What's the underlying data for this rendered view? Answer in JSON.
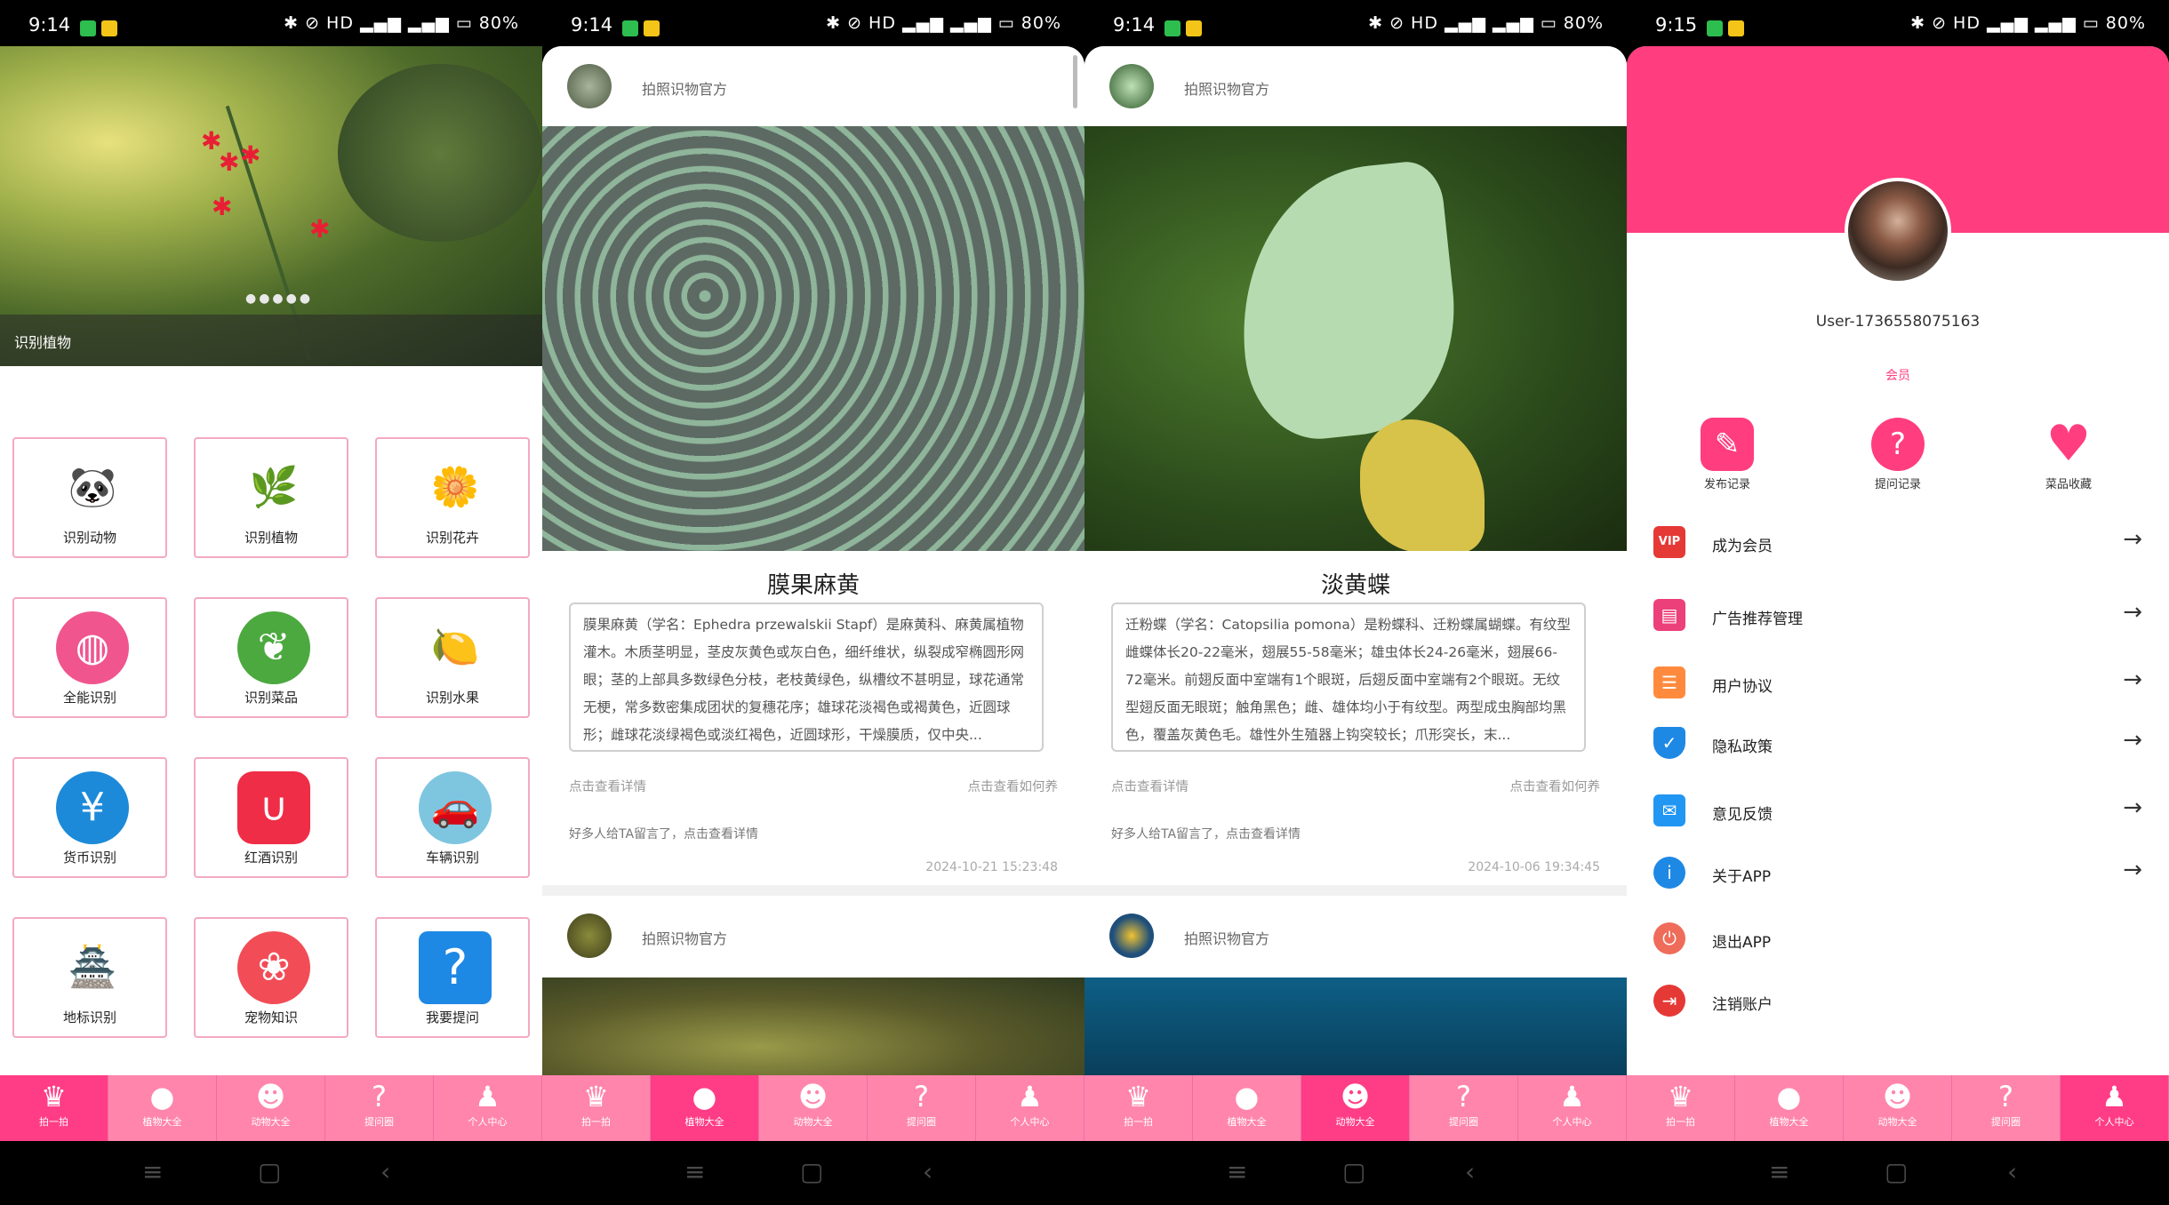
{
  "status": [
    {
      "time": "9:14",
      "battery": "80%"
    },
    {
      "time": "9:14",
      "battery": "80%"
    },
    {
      "time": "9:14",
      "battery": "80%"
    },
    {
      "time": "9:15",
      "battery": "80%"
    }
  ],
  "tabs": [
    {
      "label": "拍一拍",
      "icon": "tulip-icon"
    },
    {
      "label": "植物大全",
      "icon": "apple-icon"
    },
    {
      "label": "动物大全",
      "icon": "panda-icon"
    },
    {
      "label": "提问圈",
      "icon": "question-icon"
    },
    {
      "label": "个人中心",
      "icon": "person-icon"
    }
  ],
  "home": {
    "banner_caption": "识别植物",
    "grid": [
      {
        "label": "识别动物",
        "icon": "panda-icon",
        "color": "#ffffff"
      },
      {
        "label": "识别植物",
        "icon": "plant-icon",
        "color": "#ffffff"
      },
      {
        "label": "识别花卉",
        "icon": "flower-icon",
        "color": "#ffffff"
      },
      {
        "label": "全能识别",
        "icon": "globe-icon",
        "color": "#f0558e"
      },
      {
        "label": "识别菜品",
        "icon": "leaf-icon",
        "color": "#4ca93f"
      },
      {
        "label": "识别水果",
        "icon": "citrus-icon",
        "color": "#ffffff"
      },
      {
        "label": "货币识别",
        "icon": "money-icon",
        "color": "#1c8ad9"
      },
      {
        "label": "红酒识别",
        "icon": "wine-icon",
        "color": "#ef2d46"
      },
      {
        "label": "车辆识别",
        "icon": "car-icon",
        "color": "#7ec5e0"
      },
      {
        "label": "地标识别",
        "icon": "landmark-icon",
        "color": "#ffffff"
      },
      {
        "label": "宠物知识",
        "icon": "paw-icon",
        "color": "#f24d57"
      },
      {
        "label": "我要提问",
        "icon": "question-icon",
        "color": "#1e88e5"
      }
    ]
  },
  "plants_feed": {
    "author": "拍照识物官方",
    "title": "膜果麻黄",
    "description": "膜果麻黄（学名：Ephedra przewalskii Stapf）是麻黄科、麻黄属植物灌木。木质茎明显，茎皮灰黄色或灰白色，细纤维状，纵裂成窄椭圆形网眼；茎的上部具多数绿色分枝，老枝黄绿色，纵槽纹不甚明显，球花通常无梗，常多数密集成团状的复穗花序；雄球花淡褐色或褐黄色，近圆球形；雌球花淡绿褐色或淡红褐色，近圆球形，干燥膜质，仅中央...",
    "detail_link": "点击查看详情",
    "care_link": "点击查看如何养",
    "comment": "好多人给TA留言了，点击查看详情",
    "date": "2024-10-21 15:23:48",
    "next_author": "拍照识物官方"
  },
  "animals_feed": {
    "author": "拍照识物官方",
    "title": "淡黄蝶",
    "description": "迁粉蝶（学名：Catopsilia pomona）是粉蝶科、迁粉蝶属蝴蝶。有纹型雌蝶体长20-22毫米，翅展55-58毫米；雄虫体长24-26毫米，翅展66-72毫米。前翅反面中室端有1个眼斑，后翅反面中室端有2个眼斑。无纹型翅反面无眼斑；触角黑色；雌、雄体均小于有纹型。两型成虫胸部均黑色，覆盖灰黄色毛。雄性外生殖器上钩突较长；爪形突长，末...",
    "detail_link": "点击查看详情",
    "care_link": "点击查看如何养",
    "comment": "好多人给TA留言了，点击查看详情",
    "date": "2024-10-06 19:34:45",
    "next_author": "拍照识物官方"
  },
  "profile": {
    "username": "User-1736558075163",
    "membership": "会员",
    "actions": [
      {
        "label": "发布记录",
        "icon": "edit-icon"
      },
      {
        "label": "提问记录",
        "icon": "question-icon"
      },
      {
        "label": "菜品收藏",
        "icon": "heart-icon"
      }
    ],
    "menu": [
      {
        "label": "成为会员",
        "icon": "vip-icon",
        "color": "#e53935"
      },
      {
        "label": "广告推荐管理",
        "icon": "ad-icon",
        "color": "#ec407a"
      },
      {
        "label": "用户协议",
        "icon": "document-icon",
        "color": "#ff8a3d"
      },
      {
        "label": "隐私政策",
        "icon": "shield-icon",
        "color": "#1e88e5"
      },
      {
        "label": "意见反馈",
        "icon": "feedback-icon",
        "color": "#2196f3"
      },
      {
        "label": "关于APP",
        "icon": "info-icon",
        "color": "#1e88e5"
      },
      {
        "label": "退出APP",
        "icon": "power-icon",
        "color": "#ef6c5a"
      },
      {
        "label": "注销账户",
        "icon": "logout-icon",
        "color": "#e53935"
      }
    ]
  }
}
